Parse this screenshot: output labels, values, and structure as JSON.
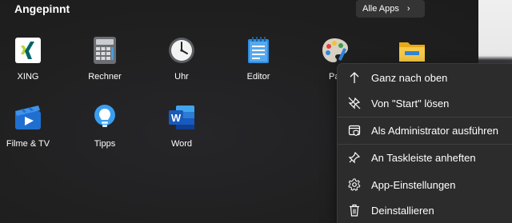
{
  "pinned": {
    "title": "Angepinnt",
    "all_apps_label": "Alle Apps",
    "apps": [
      {
        "label": "XING",
        "icon": "xing-icon"
      },
      {
        "label": "Rechner",
        "icon": "calculator-icon"
      },
      {
        "label": "Uhr",
        "icon": "clock-icon"
      },
      {
        "label": "Editor",
        "icon": "notepad-icon"
      },
      {
        "label": "Pai",
        "icon": "paint-icon"
      },
      {
        "label": "",
        "icon": "file-explorer-icon"
      },
      {
        "label": "Filme & TV",
        "icon": "movies-tv-icon"
      },
      {
        "label": "Tipps",
        "icon": "tips-icon"
      },
      {
        "label": "Word",
        "icon": "word-icon"
      }
    ]
  },
  "context_menu": {
    "items": [
      {
        "label": "Ganz nach oben",
        "icon": "arrow-up-icon"
      },
      {
        "label": "Von \"Start\" lösen",
        "icon": "unpin-icon"
      },
      {
        "label": "Als Administrator ausführen",
        "icon": "admin-shield-icon"
      },
      {
        "label": "An Taskleiste anheften",
        "icon": "pin-icon"
      },
      {
        "label": "App-Einstellungen",
        "icon": "gear-icon"
      },
      {
        "label": "Deinstallieren",
        "icon": "trash-icon"
      }
    ]
  },
  "colors": {
    "background": "#202020",
    "menu_background": "#2c2c2c",
    "word_blue": "#185abd",
    "xing_green": "#b7d436",
    "xing_teal": "#026466"
  }
}
